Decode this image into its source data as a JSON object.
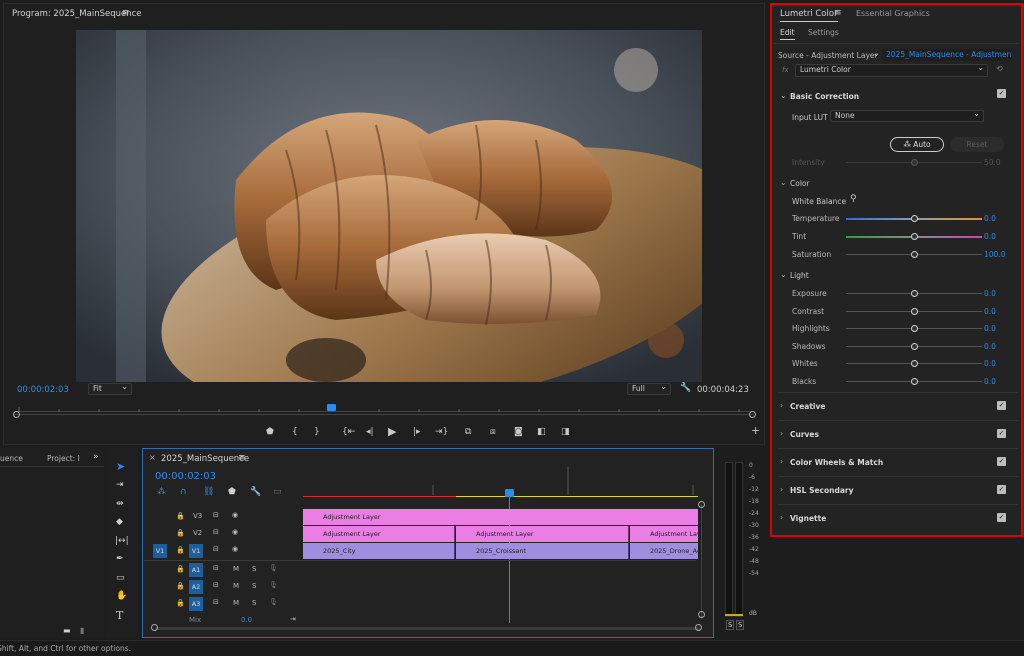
{
  "program": {
    "title": "Program: 2025_MainSequence",
    "menu_icon": "hamburger-icon",
    "timecode_current": "00:00:02:03",
    "fit_label": "Fit",
    "quality_label": "Full",
    "timecode_duration": "00:00:04:23"
  },
  "transport": {
    "controls": [
      "marker-icon",
      "in-point-icon",
      "out-point-icon",
      "go-to-in-icon",
      "step-back-icon",
      "play-icon",
      "step-forward-icon",
      "go-to-out-icon",
      "lift-icon",
      "extract-icon",
      "camera-icon",
      "compare-icon",
      "overlay-icon",
      "plus-icon"
    ]
  },
  "left_panel": {
    "tab_1": "uence",
    "tab_2": "Project: I",
    "expand": "»"
  },
  "lumetri": {
    "tab_active": "Lumetri Color",
    "tab_other": "Essential Graphics",
    "subtab_edit": "Edit",
    "subtab_settings": "Settings",
    "source_label": "Source - Adjustment Layer",
    "source_target": "2025_MainSequence - Adjustment...",
    "fx_label": "fx",
    "effect_name": "Lumetri Color",
    "basic_correction": "Basic Correction",
    "input_lut_label": "Input LUT",
    "input_lut_value": "None",
    "auto_label": "Auto",
    "reset_label": "Reset",
    "intensity_label": "Intensity",
    "intensity_value": "50.0",
    "color_label": "Color",
    "white_balance_label": "White Balance",
    "temperature_label": "Temperature",
    "temperature_value": "0.0",
    "tint_label": "Tint",
    "tint_value": "0.0",
    "saturation_label": "Saturation",
    "saturation_value": "100.0",
    "light_label": "Light",
    "exposure_label": "Exposure",
    "exposure_value": "0.0",
    "contrast_label": "Contrast",
    "contrast_value": "0.0",
    "highlights_label": "Highlights",
    "highlights_value": "0.0",
    "shadows_label": "Shadows",
    "shadows_value": "0.0",
    "whites_label": "Whites",
    "whites_value": "0.0",
    "blacks_label": "Blacks",
    "blacks_value": "0.0",
    "creative": "Creative",
    "curves": "Curves",
    "wheels": "Color Wheels & Match",
    "hsl": "HSL Secondary",
    "vignette": "Vignette"
  },
  "timeline": {
    "close": "×",
    "title": "2025_MainSequence",
    "timecode": "00:00:02:03",
    "tracks": {
      "v3": "V3",
      "v2": "V2",
      "v1": "V1",
      "v1_src": "V1",
      "a1": "A1",
      "a2": "A2",
      "a3": "A3",
      "m": "M",
      "s": "S",
      "mix": "Mix",
      "mix_value": "0.0"
    },
    "clips": {
      "v3_adj": "Adjustment Layer",
      "v2_adj1": "Adjustment Layer",
      "v2_adj2": "Adjustment Layer",
      "v2_adj3": "Adjustment Laye",
      "v1_city": "2025_City",
      "v1_croissant": "2025_Croissant",
      "v1_drone": "2025_Drone_Ae"
    }
  },
  "meter": {
    "ticks": [
      "0",
      "-6",
      "-12",
      "-18",
      "-24",
      "-30",
      "-36",
      "-42",
      "-48",
      "-54",
      "dB"
    ],
    "solo_left": "S",
    "solo_right": "S"
  },
  "status_bar": {
    "text": "Shift, Alt, and Ctrl for other options."
  },
  "colors": {
    "accent_blue": "#2d8ceb",
    "highlight_red": "#e00000",
    "clip_pink": "#ea7ee4",
    "clip_purple": "#9f8ee0"
  }
}
